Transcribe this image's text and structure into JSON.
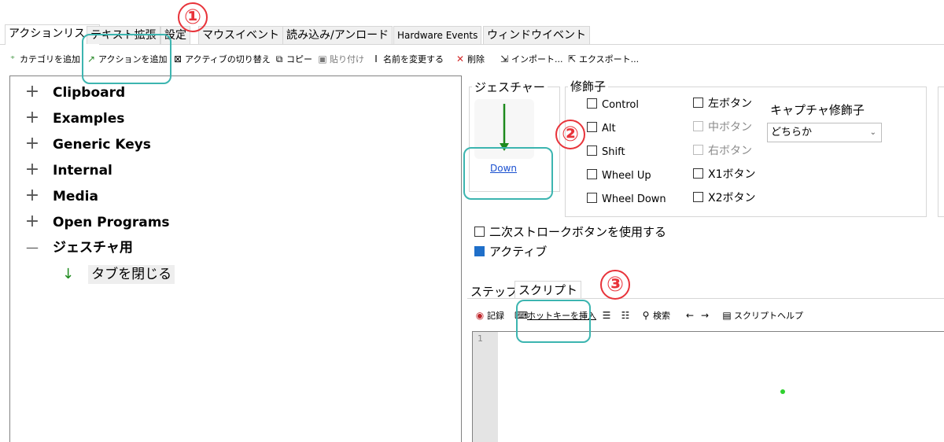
{
  "tabs": [
    {
      "label": "アクションリスト",
      "active": true
    },
    {
      "label": "テキスト拡張",
      "active": false
    },
    {
      "label": "設定",
      "active": false
    },
    {
      "label": "マウスイベント",
      "active": false
    },
    {
      "label": "読み込み/アンロード",
      "active": false
    },
    {
      "label": "Hardware Events",
      "active": false
    },
    {
      "label": "ウィンドウイベント",
      "active": false
    }
  ],
  "toolbar": {
    "add_category": "カテゴリを追加",
    "add_action": "アクションを追加",
    "toggle_active": "アクティブの切り替え",
    "copy": "コピー",
    "paste": "貼り付け",
    "rename": "名前を変更する",
    "delete": "削除",
    "import": "インポート...",
    "export": "エクスポート..."
  },
  "tree": {
    "items": [
      {
        "label": "Clipboard",
        "expander": "+"
      },
      {
        "label": "Examples",
        "expander": "+"
      },
      {
        "label": "Generic Keys",
        "expander": "+"
      },
      {
        "label": "Internal",
        "expander": "+"
      },
      {
        "label": "Media",
        "expander": "+"
      },
      {
        "label": "Open Programs",
        "expander": "+"
      },
      {
        "label": "ジェスチャ用",
        "expander": "—"
      }
    ],
    "child": {
      "label": "タブを閉じる"
    }
  },
  "gesture": {
    "title": "ジェスチャー",
    "link": "Down"
  },
  "modifiers": {
    "title": "修飾子",
    "left": [
      "Control",
      "Alt",
      "Shift",
      "Wheel Up",
      "Wheel Down"
    ],
    "right": [
      "左ボタン",
      "中ボタン",
      "右ボタン",
      "X1ボタン",
      "X2ボタン"
    ],
    "capture_title": "キャプチャ修飾子",
    "capture_value": "どちらか"
  },
  "options": {
    "secondary_stroke": "二次ストロークボタンを使用する",
    "active": "アクティブ"
  },
  "subtabs": [
    {
      "label": "ステップ",
      "active": false
    },
    {
      "label": "スクリプト",
      "active": true
    }
  ],
  "script_toolbar": {
    "record": "記録",
    "insert_hotkey": "ホットキーを挿入",
    "search": "検索",
    "help": "スクリプトヘルプ"
  },
  "editor": {
    "line_number": "1"
  },
  "annotations": [
    "①",
    "②",
    "③"
  ],
  "colors": {
    "annotation_red": "#e8333a",
    "highlight_teal": "#3cb5b0",
    "gesture_green": "#1e8a1e"
  }
}
